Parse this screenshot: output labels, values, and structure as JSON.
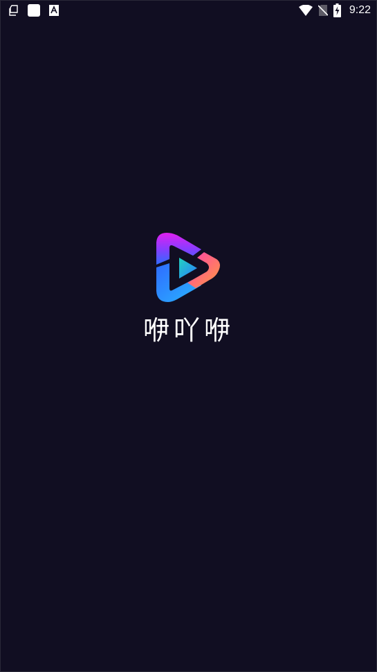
{
  "status_bar": {
    "time": "9:22",
    "icons": {
      "left": [
        "files-icon",
        "app-square-icon",
        "keyboard-a-icon"
      ],
      "right": [
        "wifi-icon",
        "no-sim-icon",
        "battery-charging-icon"
      ]
    }
  },
  "splash": {
    "app_name": "咿吖咿",
    "logo": "play-logo-icon"
  },
  "colors": {
    "background": "#110e22",
    "logo_magenta": "#e020f0",
    "logo_blue": "#2f6bff",
    "logo_orange": "#ff9a3c",
    "logo_cyan": "#22c4c8"
  }
}
